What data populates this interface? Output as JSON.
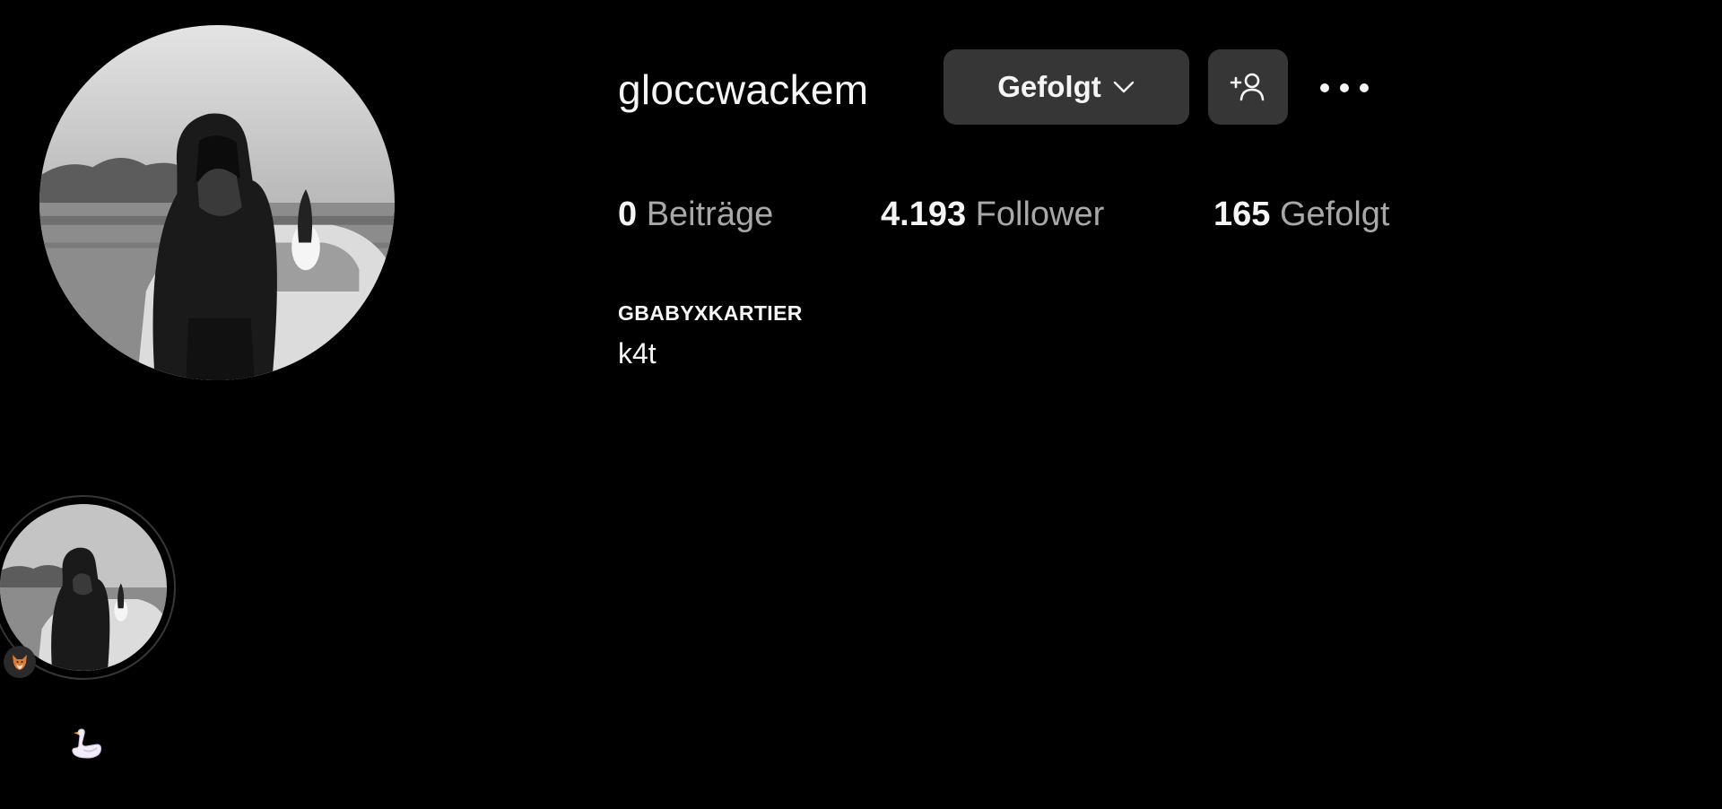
{
  "profile": {
    "username": "gloccwackem",
    "display_name": "GBABYXKARTIER",
    "bio": "k4t",
    "avatar_icon": "profile-photo"
  },
  "actions": {
    "following_label": "Gefolgt",
    "suggest_icon": "person-add-icon",
    "more_icon": "more-dots-icon"
  },
  "stats": {
    "posts": {
      "count": "0",
      "label": "Beiträge"
    },
    "followers": {
      "count": "4.193",
      "label": "Follower"
    },
    "following": {
      "count": "165",
      "label": "Gefolgt"
    }
  },
  "highlights": [
    {
      "title": "🦢",
      "badge_icon": "fox-emoji-icon"
    }
  ],
  "colors": {
    "background": "#000000",
    "button": "#363636",
    "text_primary": "#f5f5f5",
    "text_secondary": "#a8a8a8"
  }
}
